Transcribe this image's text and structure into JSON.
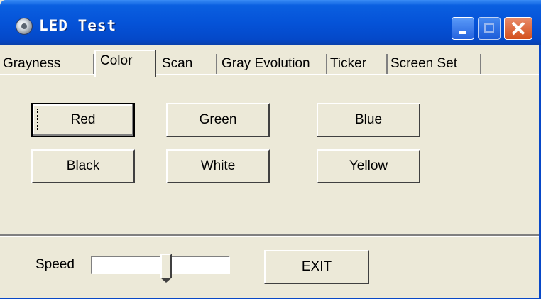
{
  "window": {
    "title": "LED Test",
    "title_bar_color": "#0553D8"
  },
  "tabs": [
    {
      "label": "Grayness",
      "active": false
    },
    {
      "label": "Color",
      "active": true
    },
    {
      "label": "Scan",
      "active": false
    },
    {
      "label": "Gray Evolution",
      "active": false
    },
    {
      "label": "Ticker",
      "active": false
    },
    {
      "label": "Screen Set",
      "active": false
    }
  ],
  "color_buttons": {
    "red": "Red",
    "green": "Green",
    "blue": "Blue",
    "black": "Black",
    "white": "White",
    "yellow": "Yellow"
  },
  "speed": {
    "label": "Speed",
    "value_fraction": 0.55
  },
  "exit_label": "EXIT"
}
